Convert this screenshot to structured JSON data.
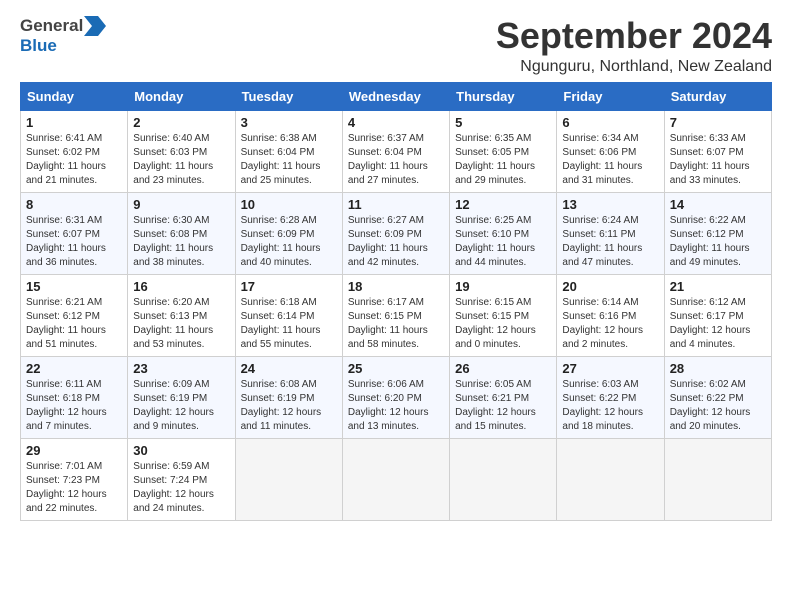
{
  "header": {
    "logo": {
      "general": "General",
      "blue": "Blue",
      "arrow_symbol": "▶"
    },
    "title": "September 2024",
    "location": "Ngunguru, Northland, New Zealand"
  },
  "calendar": {
    "days_of_week": [
      "Sunday",
      "Monday",
      "Tuesday",
      "Wednesday",
      "Thursday",
      "Friday",
      "Saturday"
    ],
    "weeks": [
      [
        {
          "day": "1",
          "sunrise": "Sunrise: 6:41 AM",
          "sunset": "Sunset: 6:02 PM",
          "daylight": "Daylight: 11 hours and 21 minutes."
        },
        {
          "day": "2",
          "sunrise": "Sunrise: 6:40 AM",
          "sunset": "Sunset: 6:03 PM",
          "daylight": "Daylight: 11 hours and 23 minutes."
        },
        {
          "day": "3",
          "sunrise": "Sunrise: 6:38 AM",
          "sunset": "Sunset: 6:04 PM",
          "daylight": "Daylight: 11 hours and 25 minutes."
        },
        {
          "day": "4",
          "sunrise": "Sunrise: 6:37 AM",
          "sunset": "Sunset: 6:04 PM",
          "daylight": "Daylight: 11 hours and 27 minutes."
        },
        {
          "day": "5",
          "sunrise": "Sunrise: 6:35 AM",
          "sunset": "Sunset: 6:05 PM",
          "daylight": "Daylight: 11 hours and 29 minutes."
        },
        {
          "day": "6",
          "sunrise": "Sunrise: 6:34 AM",
          "sunset": "Sunset: 6:06 PM",
          "daylight": "Daylight: 11 hours and 31 minutes."
        },
        {
          "day": "7",
          "sunrise": "Sunrise: 6:33 AM",
          "sunset": "Sunset: 6:07 PM",
          "daylight": "Daylight: 11 hours and 33 minutes."
        }
      ],
      [
        {
          "day": "8",
          "sunrise": "Sunrise: 6:31 AM",
          "sunset": "Sunset: 6:07 PM",
          "daylight": "Daylight: 11 hours and 36 minutes."
        },
        {
          "day": "9",
          "sunrise": "Sunrise: 6:30 AM",
          "sunset": "Sunset: 6:08 PM",
          "daylight": "Daylight: 11 hours and 38 minutes."
        },
        {
          "day": "10",
          "sunrise": "Sunrise: 6:28 AM",
          "sunset": "Sunset: 6:09 PM",
          "daylight": "Daylight: 11 hours and 40 minutes."
        },
        {
          "day": "11",
          "sunrise": "Sunrise: 6:27 AM",
          "sunset": "Sunset: 6:09 PM",
          "daylight": "Daylight: 11 hours and 42 minutes."
        },
        {
          "day": "12",
          "sunrise": "Sunrise: 6:25 AM",
          "sunset": "Sunset: 6:10 PM",
          "daylight": "Daylight: 11 hours and 44 minutes."
        },
        {
          "day": "13",
          "sunrise": "Sunrise: 6:24 AM",
          "sunset": "Sunset: 6:11 PM",
          "daylight": "Daylight: 11 hours and 47 minutes."
        },
        {
          "day": "14",
          "sunrise": "Sunrise: 6:22 AM",
          "sunset": "Sunset: 6:12 PM",
          "daylight": "Daylight: 11 hours and 49 minutes."
        }
      ],
      [
        {
          "day": "15",
          "sunrise": "Sunrise: 6:21 AM",
          "sunset": "Sunset: 6:12 PM",
          "daylight": "Daylight: 11 hours and 51 minutes."
        },
        {
          "day": "16",
          "sunrise": "Sunrise: 6:20 AM",
          "sunset": "Sunset: 6:13 PM",
          "daylight": "Daylight: 11 hours and 53 minutes."
        },
        {
          "day": "17",
          "sunrise": "Sunrise: 6:18 AM",
          "sunset": "Sunset: 6:14 PM",
          "daylight": "Daylight: 11 hours and 55 minutes."
        },
        {
          "day": "18",
          "sunrise": "Sunrise: 6:17 AM",
          "sunset": "Sunset: 6:15 PM",
          "daylight": "Daylight: 11 hours and 58 minutes."
        },
        {
          "day": "19",
          "sunrise": "Sunrise: 6:15 AM",
          "sunset": "Sunset: 6:15 PM",
          "daylight": "Daylight: 12 hours and 0 minutes."
        },
        {
          "day": "20",
          "sunrise": "Sunrise: 6:14 AM",
          "sunset": "Sunset: 6:16 PM",
          "daylight": "Daylight: 12 hours and 2 minutes."
        },
        {
          "day": "21",
          "sunrise": "Sunrise: 6:12 AM",
          "sunset": "Sunset: 6:17 PM",
          "daylight": "Daylight: 12 hours and 4 minutes."
        }
      ],
      [
        {
          "day": "22",
          "sunrise": "Sunrise: 6:11 AM",
          "sunset": "Sunset: 6:18 PM",
          "daylight": "Daylight: 12 hours and 7 minutes."
        },
        {
          "day": "23",
          "sunrise": "Sunrise: 6:09 AM",
          "sunset": "Sunset: 6:19 PM",
          "daylight": "Daylight: 12 hours and 9 minutes."
        },
        {
          "day": "24",
          "sunrise": "Sunrise: 6:08 AM",
          "sunset": "Sunset: 6:19 PM",
          "daylight": "Daylight: 12 hours and 11 minutes."
        },
        {
          "day": "25",
          "sunrise": "Sunrise: 6:06 AM",
          "sunset": "Sunset: 6:20 PM",
          "daylight": "Daylight: 12 hours and 13 minutes."
        },
        {
          "day": "26",
          "sunrise": "Sunrise: 6:05 AM",
          "sunset": "Sunset: 6:21 PM",
          "daylight": "Daylight: 12 hours and 15 minutes."
        },
        {
          "day": "27",
          "sunrise": "Sunrise: 6:03 AM",
          "sunset": "Sunset: 6:22 PM",
          "daylight": "Daylight: 12 hours and 18 minutes."
        },
        {
          "day": "28",
          "sunrise": "Sunrise: 6:02 AM",
          "sunset": "Sunset: 6:22 PM",
          "daylight": "Daylight: 12 hours and 20 minutes."
        }
      ],
      [
        {
          "day": "29",
          "sunrise": "Sunrise: 7:01 AM",
          "sunset": "Sunset: 7:23 PM",
          "daylight": "Daylight: 12 hours and 22 minutes."
        },
        {
          "day": "30",
          "sunrise": "Sunrise: 6:59 AM",
          "sunset": "Sunset: 7:24 PM",
          "daylight": "Daylight: 12 hours and 24 minutes."
        },
        null,
        null,
        null,
        null,
        null
      ]
    ]
  }
}
